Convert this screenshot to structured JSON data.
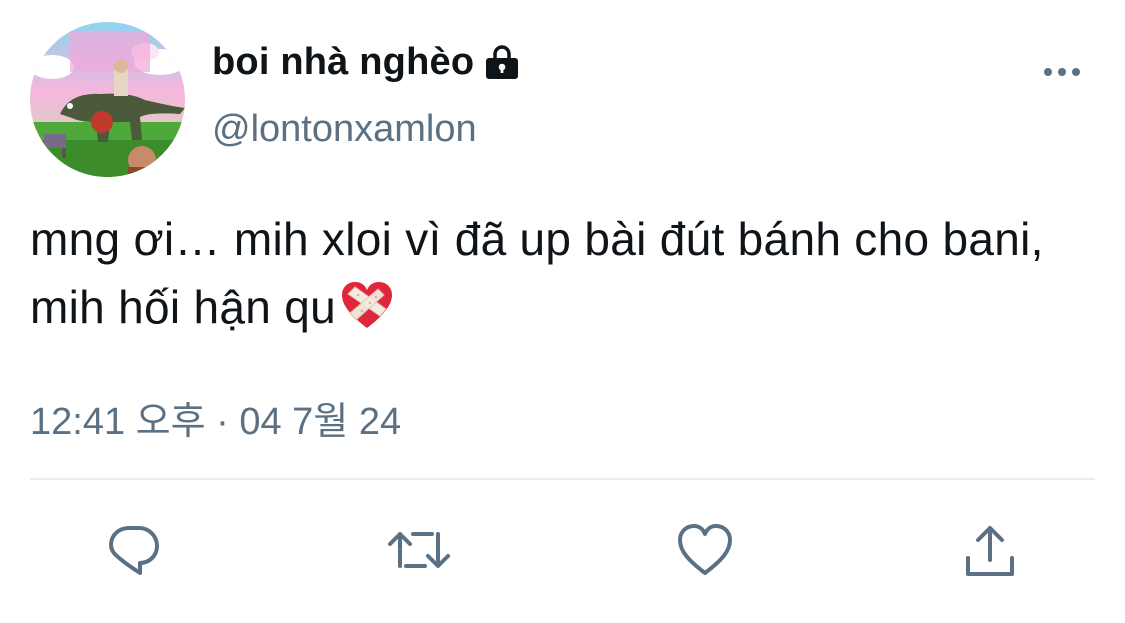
{
  "user": {
    "display_name": "boi nhà nghèo",
    "handle": "@lontonxamlon",
    "protected_icon": "lock-icon",
    "avatar": "profile-avatar"
  },
  "tweet": {
    "text": "mng ơi… mih xloi vì đã up bài đút bánh cho bani, mih hối hận qu",
    "emoji": "mending-heart-emoji",
    "time": "12:41 오후",
    "separator": "·",
    "date": "04 7월 24"
  },
  "actions": [
    {
      "name": "reply",
      "icon": "reply-icon"
    },
    {
      "name": "retweet",
      "icon": "retweet-icon"
    },
    {
      "name": "like",
      "icon": "heart-icon"
    },
    {
      "name": "share",
      "icon": "share-icon"
    }
  ],
  "more_icon": "more-icon",
  "colors": {
    "primary_text": "#0f1419",
    "secondary_text": "#5b7083",
    "icon": "#5b7083",
    "divider": "#e6ecf0",
    "background": "#ffffff"
  }
}
